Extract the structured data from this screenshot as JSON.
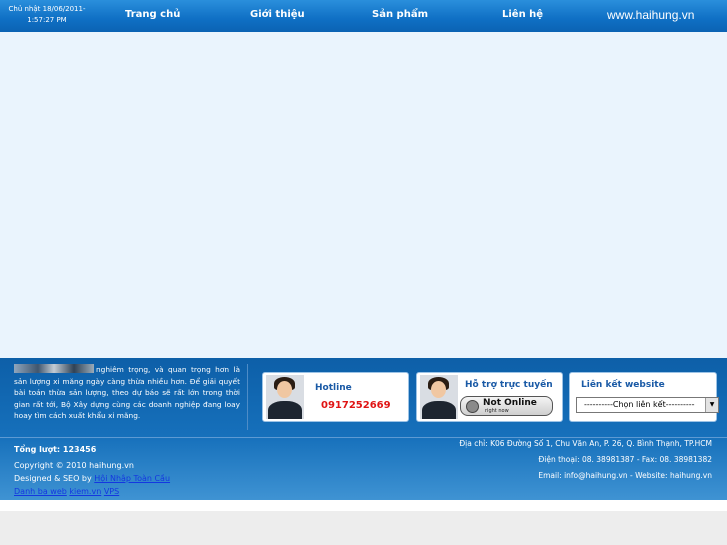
{
  "header": {
    "datetime_line1": "Chủ nhật 18/06/2011-",
    "datetime_line2": "1:57:27 PM",
    "nav": [
      "Trang chủ",
      "Giới thiệu",
      "Sản phẩm",
      "Liên hệ"
    ],
    "site": "www.haihung.vn"
  },
  "intro": {
    "text": "nghiêm trọng, và quan trọng hơn là sản lượng xi măng ngày càng thừa nhiều hơn. Để giải quyết bài toán thừa sản lượng, theo dự báo sẽ rất lớn trong thời gian rất tới, Bộ Xây dựng cùng các doanh nghiệp đang loay hoay tìm cách xuất khẩu xi măng."
  },
  "hotline": {
    "title": "Hotline",
    "number": "0917252669"
  },
  "support": {
    "title": "Hỗ trợ trực tuyến",
    "status_main": "Not Online",
    "status_sub": "right now"
  },
  "links": {
    "title": "Liên kết website",
    "select_value": "----------Chọn liên kết----------"
  },
  "footer": {
    "counter": "Tổng lượt: 123456",
    "copyright": "Copyright © 2010 haihung.vn",
    "designed_prefix": "Designed & SEO by",
    "designed_link": "Hội Nhập Toàn Cầu",
    "links": [
      "Danh bạ web",
      "kiem.vn",
      "VPS"
    ],
    "address": "Địa chỉ: K06 Đường Số 1, Chu Văn An, P. 26, Q. Bình Thạnh, TP.HCM",
    "phone": "Điện thoại: 08. 38981387 - Fax: 08. 38981382",
    "email": "Email: info@haihung.vn - Website: haihung.vn"
  }
}
